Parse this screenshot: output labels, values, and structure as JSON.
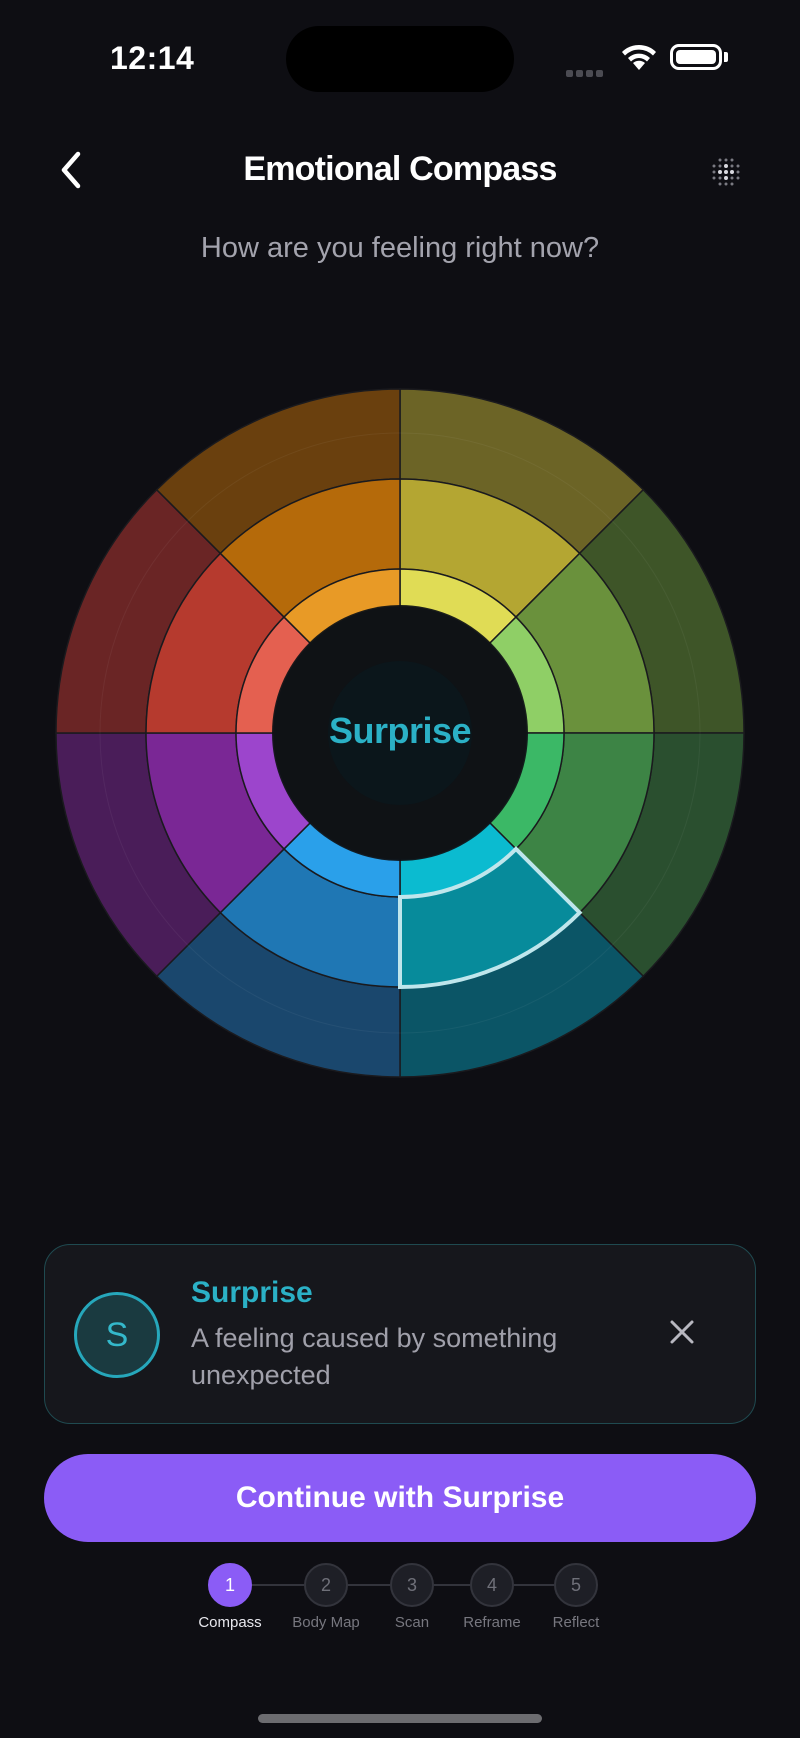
{
  "status_bar": {
    "time": "12:14"
  },
  "header": {
    "title": "Emotional Compass",
    "back_icon": "chevron-left-icon",
    "menu_icon": "dot-grid-icon"
  },
  "prompt": "How are you feeling right now?",
  "wheel": {
    "selected_emotion": "Surprise",
    "segments": [
      {
        "id": "joy",
        "outer": "#6c6426",
        "mid": "#b4a632",
        "inner": "#e0dc55"
      },
      {
        "id": "trust",
        "outer": "#3e5528",
        "mid": "#6a913c",
        "inner": "#8fcf66"
      },
      {
        "id": "fear",
        "outer": "#2a4f2f",
        "mid": "#3d8445",
        "inner": "#3bb866"
      },
      {
        "id": "surprise",
        "outer": "#0b5566",
        "mid": "#078b9b",
        "inner": "#0bbbd0"
      },
      {
        "id": "sadness",
        "outer": "#1a476d",
        "mid": "#1f77b4",
        "inner": "#2aa0ea"
      },
      {
        "id": "disgust",
        "outer": "#4a1d59",
        "mid": "#7a2795",
        "inner": "#9c45cc"
      },
      {
        "id": "anger",
        "outer": "#6a2525",
        "mid": "#b63a2e",
        "inner": "#e46050"
      },
      {
        "id": "anticipation",
        "outer": "#6a400e",
        "mid": "#b56a0a",
        "inner": "#e89a26"
      }
    ],
    "selected_index": 3,
    "highlight_color": "#bfe6ec"
  },
  "card": {
    "avatar_letter": "S",
    "title": "Surprise",
    "description": "A feeling caused by something unexpected",
    "close_icon": "close-icon"
  },
  "continue_label": "Continue with Surprise",
  "steps": [
    {
      "number": "1",
      "label": "Compass"
    },
    {
      "number": "2",
      "label": "Body Map"
    },
    {
      "number": "3",
      "label": "Scan"
    },
    {
      "number": "4",
      "label": "Reframe"
    },
    {
      "number": "5",
      "label": "Reflect"
    }
  ],
  "active_step": 1,
  "colors": {
    "accent": "#8b5cf6",
    "selected": "#2bb1c6",
    "background": "#0e0e13"
  }
}
